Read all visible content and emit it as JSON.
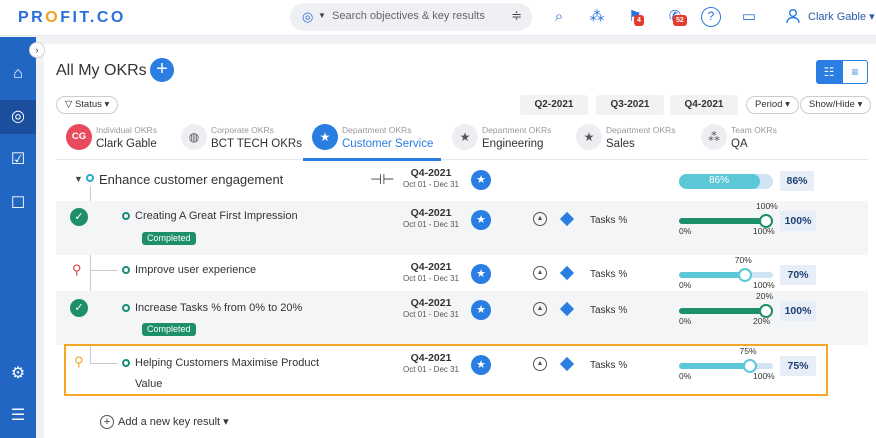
{
  "app": {
    "logo_left": "PR",
    "logo_o": "O",
    "logo_right": "FIT.CO",
    "search_placeholder": "Search objectives & key results",
    "notifications": {
      "alerts": "4",
      "messages": "52"
    },
    "user_name": "Clark Gable"
  },
  "page": {
    "title": "All My OKRs"
  },
  "filters": {
    "status": "Status",
    "quarters": [
      "Q2-2021",
      "Q3-2021",
      "Q4-2021"
    ],
    "period": "Period",
    "show_hide": "Show/Hide"
  },
  "tabs": [
    {
      "sub": "Individual OKRs",
      "name": "Clark Gable",
      "avatar": "CG"
    },
    {
      "sub": "Corporate OKRs",
      "name": "BCT TECH OKRs"
    },
    {
      "sub": "Department OKRs",
      "name": "Customer Service"
    },
    {
      "sub": "Department OKRs",
      "name": "Engineering"
    },
    {
      "sub": "Department OKRs",
      "name": "Sales"
    },
    {
      "sub": "Team OKRs",
      "name": "QA"
    }
  ],
  "objective": {
    "title": "Enhance customer engagement",
    "quarter": "Q4-2021",
    "dates": "Oct 01 - Dec 31",
    "progress_label": "86%",
    "progress_value": "86%",
    "progress_fraction": 0.86
  },
  "key_results": [
    {
      "title": "Creating A Great First Impression",
      "quarter": "Q4-2021",
      "dates": "Oct 01 - Dec 31",
      "badge": "Completed",
      "metric": "Tasks %",
      "start": "0%",
      "target": "100%",
      "current": "100%",
      "progress": "100%",
      "progress_fraction": 1.0,
      "status_icon": "check-icon"
    },
    {
      "title": "Improve user experience",
      "quarter": "Q4-2021",
      "dates": "Oct 01 - Dec 31",
      "metric": "Tasks %",
      "start": "0%",
      "target": "100%",
      "current": "70%",
      "progress": "70%",
      "progress_fraction": 0.7,
      "status_icon": "map-pin-icon"
    },
    {
      "title": "Increase Tasks % from 0% to 20%",
      "quarter": "Q4-2021",
      "dates": "Oct 01 - Dec 31",
      "badge": "Completed",
      "metric": "Tasks %",
      "start": "0%",
      "target": "20%",
      "current": "20%",
      "progress": "100%",
      "progress_fraction": 1.0,
      "status_icon": "check-icon"
    },
    {
      "title": "Helping Customers Maximise Product",
      "title_line2": "Value",
      "quarter": "Q4-2021",
      "dates": "Oct 01 - Dec 31",
      "metric": "Tasks %",
      "start": "0%",
      "target": "100%",
      "current": "75%",
      "progress": "75%",
      "progress_fraction": 0.75,
      "status_icon": "map-pin-icon"
    }
  ],
  "add_key_result": "Add a new key result",
  "colors": {
    "brand": "#2a7de1",
    "sidebar": "#2266c4",
    "completed": "#1e8f6b",
    "progress_light": "#5bc8d8",
    "highlight": "#f5a623"
  }
}
